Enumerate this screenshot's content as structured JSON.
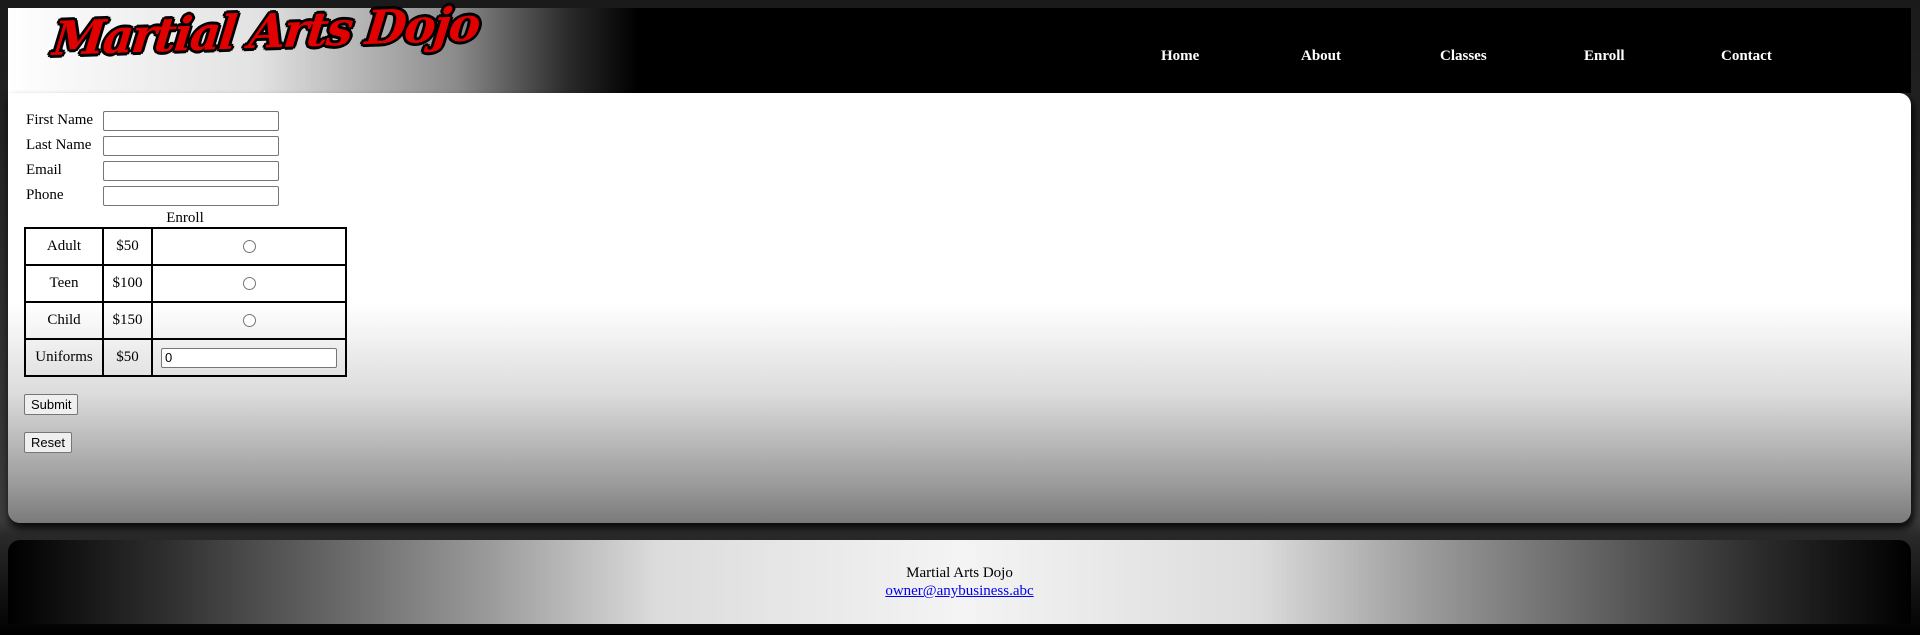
{
  "header": {
    "logo_text": "Martial Arts Dojo",
    "nav": [
      "Home",
      "About",
      "Classes",
      "Enroll",
      "Contact"
    ]
  },
  "form": {
    "fields": [
      {
        "label": "First Name",
        "value": ""
      },
      {
        "label": "Last Name",
        "value": ""
      },
      {
        "label": "Email",
        "value": ""
      },
      {
        "label": "Phone",
        "value": ""
      }
    ],
    "enroll_caption": "Enroll",
    "options": [
      {
        "name": "Adult",
        "price": "$50"
      },
      {
        "name": "Teen",
        "price": "$100"
      },
      {
        "name": "Child",
        "price": "$150"
      }
    ],
    "uniforms": {
      "name": "Uniforms",
      "price": "$50",
      "quantity": "0"
    },
    "submit_label": "Submit",
    "reset_label": "Reset"
  },
  "footer": {
    "name": "Martial Arts Dojo",
    "email": "owner@anybusiness.abc"
  },
  "colors": {
    "logo_red": "#e00000",
    "nav_text": "#ffffff",
    "link": "#0000ee"
  }
}
